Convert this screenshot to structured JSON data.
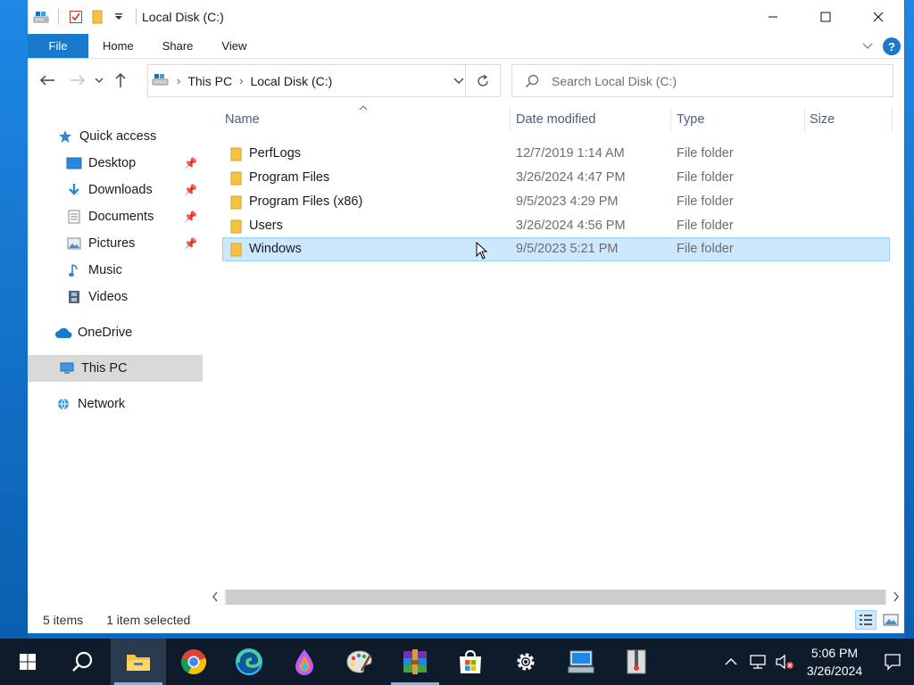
{
  "window": {
    "title": "Local Disk (C:)",
    "quick_access_toolbar": [
      "drive-icon",
      "properties-check-icon",
      "new-folder-icon",
      "customize-dropdown-icon"
    ],
    "controls": [
      "minimize-icon",
      "maximize-icon",
      "close-icon"
    ]
  },
  "ribbon": {
    "tabs": [
      {
        "label": "File",
        "active": true
      },
      {
        "label": "Home"
      },
      {
        "label": "Share"
      },
      {
        "label": "View"
      }
    ]
  },
  "address": {
    "segments": [
      "This PC",
      "Local Disk (C:)"
    ],
    "search_placeholder": "Search Local Disk (C:)"
  },
  "nav_pane": {
    "items": [
      {
        "label": "Quick access",
        "icon": "star-icon",
        "level": 0,
        "pinned": false
      },
      {
        "label": "Desktop",
        "icon": "desktop-icon",
        "level": 1,
        "pinned": true
      },
      {
        "label": "Downloads",
        "icon": "download-arrow-icon",
        "level": 1,
        "pinned": true
      },
      {
        "label": "Documents",
        "icon": "document-icon",
        "level": 1,
        "pinned": true
      },
      {
        "label": "Pictures",
        "icon": "picture-icon",
        "level": 1,
        "pinned": true
      },
      {
        "label": "Music",
        "icon": "music-note-icon",
        "level": 1,
        "pinned": false
      },
      {
        "label": "Videos",
        "icon": "film-icon",
        "level": 1,
        "pinned": false
      },
      {
        "label": "OneDrive",
        "icon": "cloud-icon",
        "level": 0,
        "pinned": false
      },
      {
        "label": "This PC",
        "icon": "computer-icon",
        "level": 0,
        "pinned": false,
        "selected": true
      },
      {
        "label": "Network",
        "icon": "network-icon",
        "level": 0,
        "pinned": false
      }
    ]
  },
  "file_list": {
    "columns": [
      "Name",
      "Date modified",
      "Type",
      "Size"
    ],
    "sort_column": "Name",
    "rows": [
      {
        "name": "PerfLogs",
        "date": "12/7/2019 1:14 AM",
        "type": "File folder",
        "size": "",
        "selected": false
      },
      {
        "name": "Program Files",
        "date": "3/26/2024 4:47 PM",
        "type": "File folder",
        "size": "",
        "selected": false
      },
      {
        "name": "Program Files (x86)",
        "date": "9/5/2023 4:29 PM",
        "type": "File folder",
        "size": "",
        "selected": false
      },
      {
        "name": "Users",
        "date": "3/26/2024 4:56 PM",
        "type": "File folder",
        "size": "",
        "selected": false
      },
      {
        "name": "Windows",
        "date": "9/5/2023 5:21 PM",
        "type": "File folder",
        "size": "",
        "selected": true
      }
    ]
  },
  "status": {
    "item_count": "5 items",
    "selection": "1 item selected"
  },
  "taskbar": {
    "apps": [
      "start-icon",
      "search-icon",
      "file-explorer-icon",
      "chrome-icon",
      "edge-icon",
      "paint-drop-icon",
      "paint-palette-icon",
      "winrar-icon",
      "store-icon",
      "settings-gear-icon",
      "remote-desktop-icon",
      "zip-archive-icon"
    ],
    "clock_time": "5:06 PM",
    "clock_date": "3/26/2024"
  },
  "colors": {
    "accent": "#1979ca",
    "selection_bg": "#cce8ff",
    "selection_border": "#99d1ff",
    "folder": "#f5c242",
    "taskbar": "#0e1b2b"
  }
}
